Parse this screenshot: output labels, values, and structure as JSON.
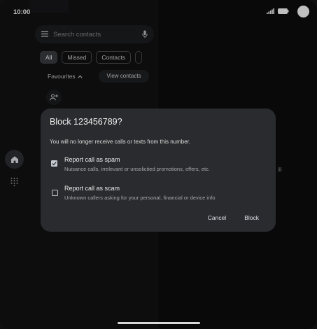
{
  "status_bar": {
    "time": "10:00"
  },
  "search": {
    "placeholder": "Search contacts"
  },
  "chips": [
    {
      "label": "All",
      "active": true
    },
    {
      "label": "Missed",
      "active": false
    },
    {
      "label": "Contacts",
      "active": false
    },
    {
      "label": "",
      "active": false
    }
  ],
  "favourites": {
    "label": "Favourites"
  },
  "view_contacts": {
    "label": "View contacts"
  },
  "right_pane": {
    "hint_text": "ill"
  },
  "dialog": {
    "title": "Block 123456789?",
    "body": "You will no longer receive calls or texts from this number.",
    "options": [
      {
        "title": "Report call as spam",
        "subtitle": "Nuisance calls, irrelevant or unsolicited promotions, offers, etc.",
        "checked": true
      },
      {
        "title": "Report call as scam",
        "subtitle": "Unknown callers asking for your personal, financial or device info",
        "checked": false
      }
    ],
    "cancel_label": "Cancel",
    "block_label": "Block"
  },
  "icons": {
    "home": "home-icon",
    "dialpad": "dialpad-icon",
    "menu": "menu-icon",
    "mic": "mic-icon",
    "add_person": "add-person-icon",
    "chevron_up": "chevron-up-icon",
    "signal": "signal-icon",
    "battery": "battery-icon"
  },
  "colors": {
    "dialog_bg": "#2a2b2e",
    "checkbox_checked": "#c7cbd3",
    "active_chip": "#3a3c40",
    "background": "#0c0c0d"
  }
}
